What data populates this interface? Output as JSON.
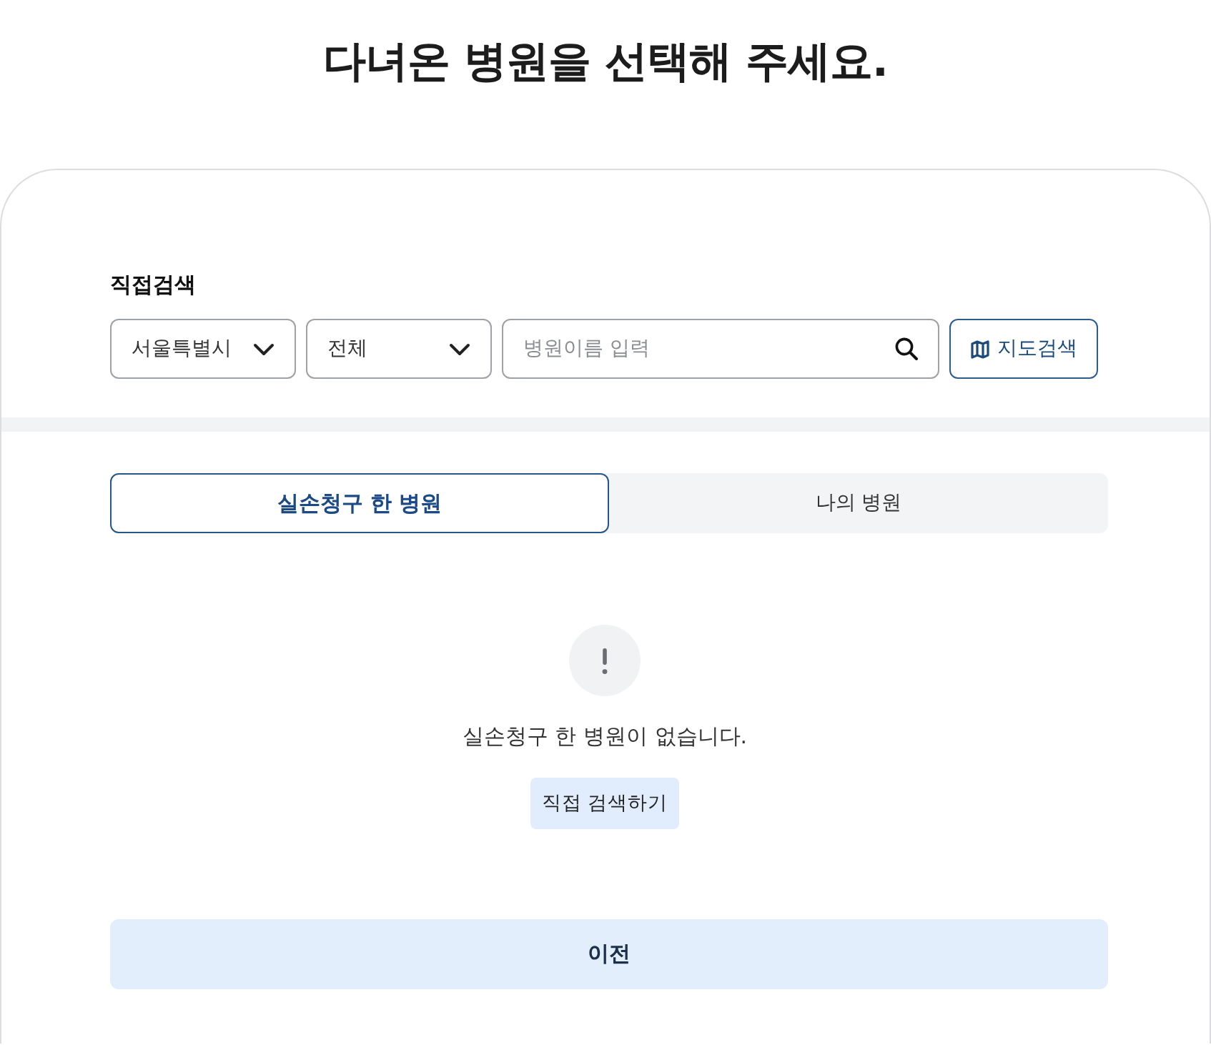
{
  "page": {
    "title": "다녀온 병원을 선택해 주세요."
  },
  "search": {
    "label": "직접검색",
    "region_select": {
      "value": "서울특별시"
    },
    "district_select": {
      "value": "전체"
    },
    "name_field": {
      "placeholder": "병원이름 입력"
    },
    "map_button": {
      "label": "지도검색"
    }
  },
  "tabs": [
    {
      "label": "실손청구 한 병원",
      "selected": true
    },
    {
      "label": "나의 병원",
      "selected": false
    }
  ],
  "empty_state": {
    "message": "실손청구 한 병원이 없습니다.",
    "action_button": "직접 검색하기"
  },
  "footer": {
    "back_button": "이전"
  }
}
